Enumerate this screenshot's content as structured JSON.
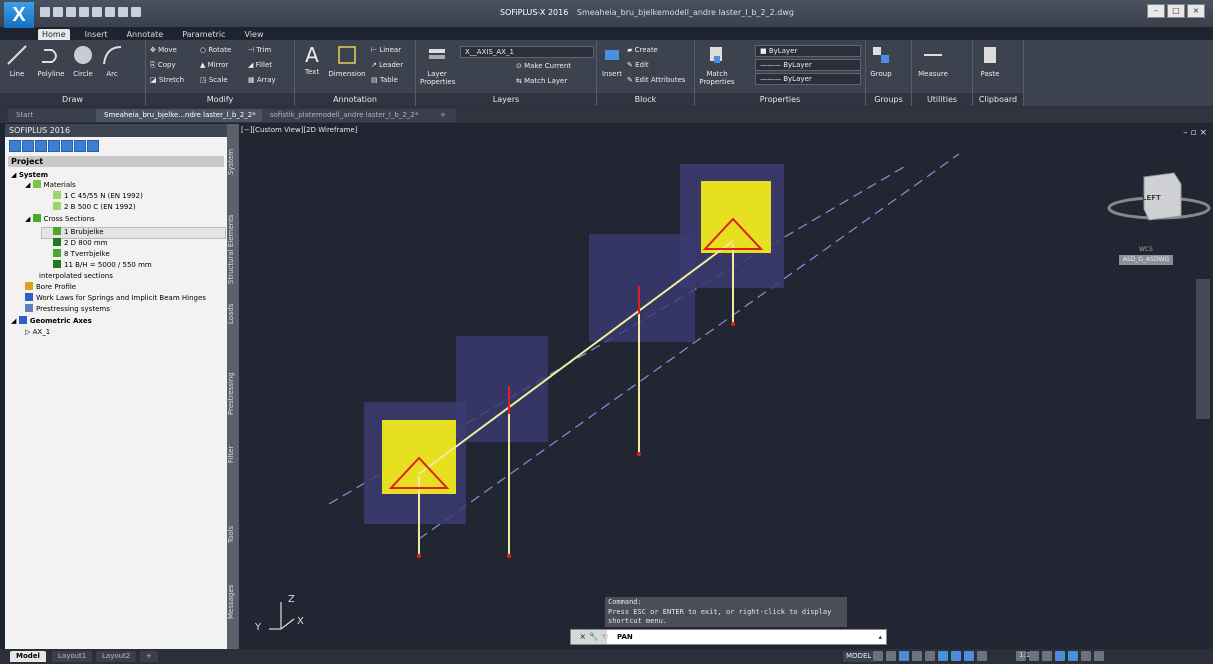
{
  "app": {
    "product": "SOFiPLUS-X 2016",
    "filename": "Smeaheia_bru_bjelkemodell_andre laster_l_b_2_2.dwg"
  },
  "ribbon_tabs": [
    "Home",
    "Insert",
    "Annotate",
    "Parametric",
    "View"
  ],
  "draw": {
    "line": "Line",
    "polyline": "Polyline",
    "circle": "Circle",
    "arc": "Arc",
    "panel": "Draw"
  },
  "modify": {
    "move": "Move",
    "rotate": "Rotate",
    "trim": "Trim",
    "copy": "Copy",
    "mirror": "Mirror",
    "fillet": "Fillet",
    "stretch": "Stretch",
    "scale": "Scale",
    "array": "Array",
    "panel": "Modify"
  },
  "annotation": {
    "text": "Text",
    "dimension": "Dimension",
    "linear": "Linear",
    "leader": "Leader",
    "table": "Table",
    "panel": "Annotation"
  },
  "layers": {
    "layer_properties": "Layer Properties",
    "current_layer": "X__AXIS_AX_1",
    "make_current": "Make Current",
    "match_layer": "Match Layer",
    "panel": "Layers"
  },
  "block": {
    "insert": "Insert",
    "create": "Create",
    "edit": "Edit",
    "edit_attributes": "Edit Attributes",
    "panel": "Block"
  },
  "properties": {
    "match_properties": "Match Properties",
    "color": "ByLayer",
    "linetype": "ByLayer",
    "lineweight": "ByLayer",
    "panel": "Properties"
  },
  "groups": {
    "group": "Group",
    "panel": "Groups"
  },
  "utilities": {
    "measure": "Measure",
    "panel": "Utilities"
  },
  "clipboard": {
    "paste": "Paste",
    "panel": "Clipboard"
  },
  "doc_tabs": [
    {
      "label": "Start"
    },
    {
      "label": "Smeaheia_bru_bjelke...ndre laster_l_b_2_2*"
    },
    {
      "label": "sofistik_platemodell_andre laster_l_b_2_2*"
    }
  ],
  "palette": {
    "title": "SOFIPLUS 2016",
    "project": "Project",
    "tree": {
      "system": "System",
      "materials": "Materials",
      "mat1": "1 C 45/55 N (EN 1992)",
      "mat2": "2 B 500 C (EN 1992)",
      "cross_sections": "Cross Sections",
      "cs1": "1 Brubjelke",
      "cs2": "2 D 800 mm",
      "cs3": "8 Tverrbjelke",
      "cs4": "11 B/H = 5000 / 550 mm",
      "interp": "interpolated sections",
      "bore": "Bore Profile",
      "work_laws": "Work Laws for Springs and Implicit Beam Hinges",
      "prestress": "Prestressing systems",
      "geo_axes": "Geometric Axes",
      "ax1": "AX_1"
    },
    "side_tabs": [
      "System",
      "Structural Elements",
      "Loads",
      "Prestressing",
      "Filter",
      "Tools",
      "Messages"
    ]
  },
  "viewport": {
    "label": "[−][Custom View][2D Wireframe]",
    "viewcube_face": "LEFT",
    "wcs": "WCS",
    "ucs": "ASD_G_ASDWG",
    "axis_z": "Z",
    "axis_x": "X",
    "axis_y": "Y"
  },
  "command": {
    "history": [
      "Command:",
      "Press ESC or ENTER to exit, or right-click to display",
      "shortcut menu."
    ],
    "current": "PAN"
  },
  "status": {
    "layout_tabs": [
      "Model",
      "Layout1",
      "Layout2"
    ],
    "model": "MODEL",
    "scale": "1:1"
  },
  "colors": {
    "beam_line": "#f0eb9a",
    "pier": "#e6e020",
    "support_red": "#e02020",
    "plate": "#3a3a6e",
    "axis": "#8a8ee0"
  }
}
